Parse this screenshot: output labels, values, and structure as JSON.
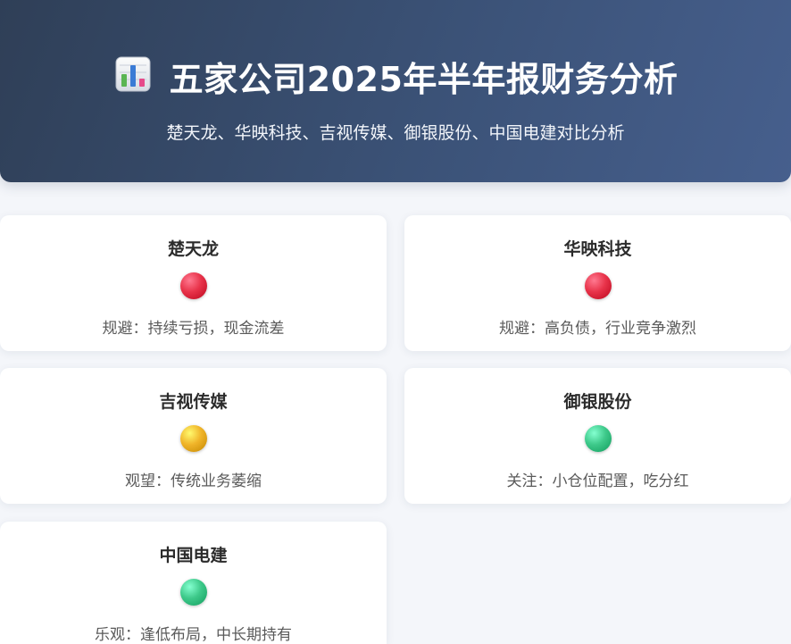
{
  "header": {
    "icon": "bar-chart-icon",
    "title": "五家公司2025年半年报财务分析",
    "subtitle": "楚天龙、华映科技、吉视传媒、御银股份、中国电建对比分析"
  },
  "colors": {
    "red": "#e8334a",
    "yellow": "#f0b429",
    "green": "#3ec98a"
  },
  "companies": [
    {
      "name": "楚天龙",
      "status": "red",
      "note": "规避：持续亏损，现金流差"
    },
    {
      "name": "华映科技",
      "status": "red",
      "note": "规避：高负债，行业竞争激烈"
    },
    {
      "name": "吉视传媒",
      "status": "yellow",
      "note": "观望：传统业务萎缩"
    },
    {
      "name": "御银股份",
      "status": "green",
      "note": "关注：小仓位配置，吃分红"
    },
    {
      "name": "中国电建",
      "status": "green",
      "note": "乐观：逢低布局，中长期持有"
    }
  ]
}
